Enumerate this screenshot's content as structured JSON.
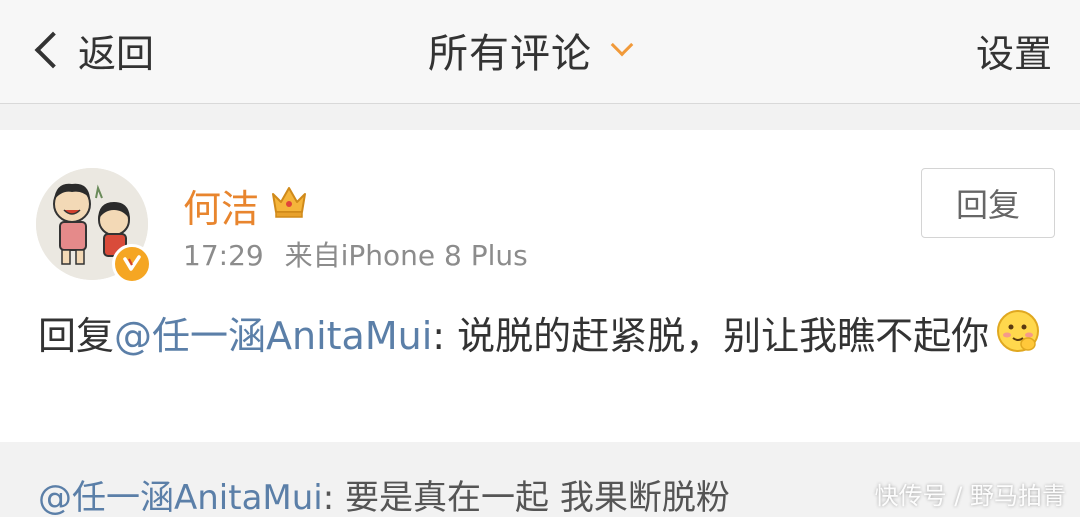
{
  "navbar": {
    "back_label": "返回",
    "title": "所有评论",
    "settings_label": "设置"
  },
  "comment": {
    "author": "何洁",
    "time": "17:29",
    "source": "来自iPhone 8 Plus",
    "reply_button": "回复",
    "reply_prefix": "回复",
    "mention": "@任一涵AnitaMui",
    "text": ": 说脱的赶紧脱，别让我瞧不起你"
  },
  "quoted": {
    "mention": "@任一涵AnitaMui",
    "text": ": 要是真在一起 我果断脱粉"
  },
  "watermark": "快传号 / 野马拍青",
  "icons": {
    "back": "chevron-left-icon",
    "title_dropdown": "chevron-down-icon",
    "crown": "crown-icon",
    "verified": "verified-badge-icon",
    "emoji": "shy-smile-emoji-icon"
  },
  "colors": {
    "accent": "#f19a3a",
    "username": "#e8852e",
    "mention": "#5b7fa8",
    "meta": "#8c8c8c"
  }
}
